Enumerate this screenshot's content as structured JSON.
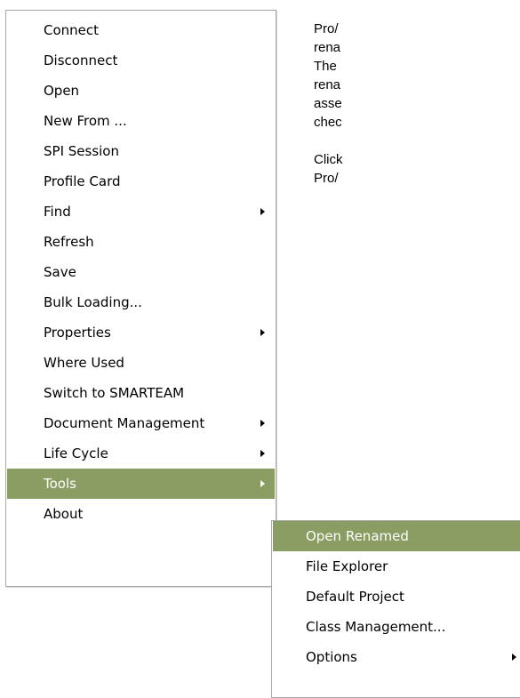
{
  "accent_color": "#8a9d63",
  "side_text": {
    "line1": "Pro/",
    "line2": "rena",
    "line3": "The",
    "line4": "rena",
    "line5": "asse",
    "line6": "chec",
    "line7": "Click",
    "line8": "Pro/"
  },
  "menu": {
    "items": [
      {
        "label": "Connect"
      },
      {
        "label": "Disconnect"
      },
      {
        "label": "Open"
      },
      {
        "label": "New From ..."
      },
      {
        "label": "SPI Session"
      },
      {
        "label": "Profile Card"
      },
      {
        "label": "Find",
        "submenu": true
      },
      {
        "label": "Refresh"
      },
      {
        "label": "Save"
      },
      {
        "label": "Bulk Loading..."
      },
      {
        "label": "Properties",
        "submenu": true
      },
      {
        "label": "Where Used"
      },
      {
        "label": "Switch to SMARTEAM"
      },
      {
        "label": "Document Management",
        "submenu": true
      },
      {
        "label": "Life Cycle",
        "submenu": true
      },
      {
        "label": "Tools",
        "submenu": true,
        "selected": true
      },
      {
        "label": "About"
      }
    ]
  },
  "submenu": {
    "items": [
      {
        "label": "Open Renamed",
        "selected": true
      },
      {
        "label": "File Explorer"
      },
      {
        "label": "Default Project"
      },
      {
        "label": "Class Management..."
      },
      {
        "label": "Options",
        "submenu": true
      }
    ]
  }
}
